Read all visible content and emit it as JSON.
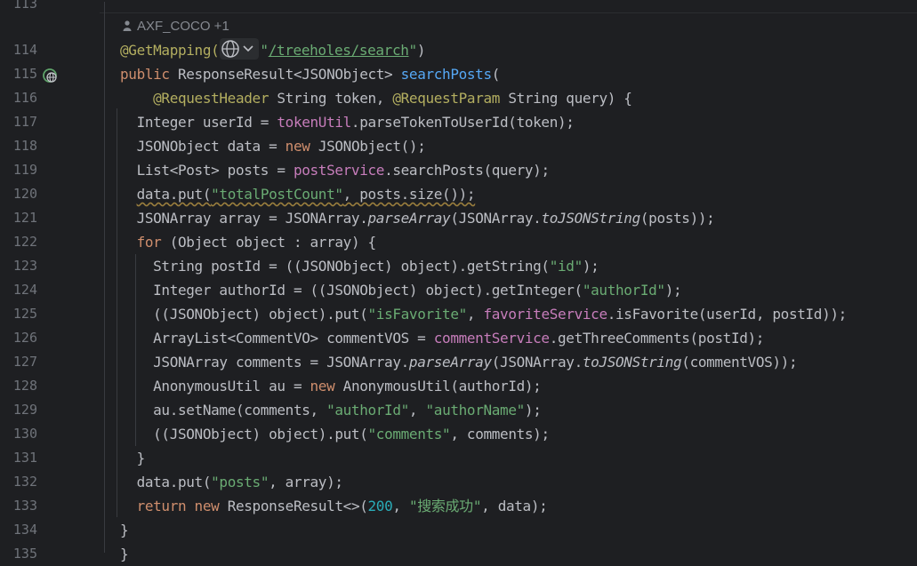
{
  "author_hint": "AXF_COCO +1",
  "lines": [
    {
      "n": "113",
      "t": []
    },
    {
      "n": "114",
      "t": [
        [
          "ann",
          "@GetMapping("
        ],
        [
          "globe",
          ""
        ],
        [
          "str",
          "\""
        ],
        [
          "url",
          "/treeholes/search"
        ],
        [
          "str",
          "\""
        ],
        [
          "",
          ")"
        ]
      ]
    },
    {
      "n": "115",
      "t": [
        [
          "kw",
          "public "
        ],
        [
          "",
          "ResponseResult<JSONObject> "
        ],
        [
          "fn",
          "searchPosts"
        ],
        [
          "",
          "("
        ]
      ]
    },
    {
      "n": "116",
      "t": [
        [
          "",
          "    "
        ],
        [
          "ann",
          "@RequestHeader "
        ],
        [
          "",
          "String token, "
        ],
        [
          "ann",
          "@RequestParam "
        ],
        [
          "",
          "String query) {"
        ]
      ]
    },
    {
      "n": "117",
      "t": [
        [
          "",
          "  Integer userId = "
        ],
        [
          "fld",
          "tokenUtil"
        ],
        [
          "",
          ".parseTokenToUserId(token);"
        ]
      ]
    },
    {
      "n": "118",
      "t": [
        [
          "",
          "  JSONObject data = "
        ],
        [
          "kw",
          "new "
        ],
        [
          "",
          "JSONObject();"
        ]
      ]
    },
    {
      "n": "119",
      "t": [
        [
          "",
          "  List<Post> posts = "
        ],
        [
          "fld",
          "postService"
        ],
        [
          "",
          ".searchPosts(query);"
        ]
      ]
    },
    {
      "n": "120",
      "t": [
        [
          "",
          "  "
        ],
        [
          "sq",
          "data.put("
        ],
        [
          "sqs",
          "\"totalPostCount\""
        ],
        [
          "sq",
          ", posts.size());"
        ]
      ]
    },
    {
      "n": "121",
      "t": [
        [
          "",
          "  JSONArray array = JSONArray."
        ],
        [
          "it",
          "parseArray"
        ],
        [
          "",
          "(JSONArray."
        ],
        [
          "it",
          "toJSONString"
        ],
        [
          "",
          "(posts));"
        ]
      ]
    },
    {
      "n": "122",
      "t": [
        [
          "",
          "  "
        ],
        [
          "kw",
          "for "
        ],
        [
          "",
          "(Object object : array) {"
        ]
      ]
    },
    {
      "n": "123",
      "t": [
        [
          "",
          "    String postId = ((JSONObject) object).getString("
        ],
        [
          "str",
          "\"id\""
        ],
        [
          "",
          ");"
        ]
      ]
    },
    {
      "n": "124",
      "t": [
        [
          "",
          "    Integer authorId = ((JSONObject) object).getInteger("
        ],
        [
          "str",
          "\"authorId\""
        ],
        [
          "",
          ");"
        ]
      ]
    },
    {
      "n": "125",
      "t": [
        [
          "",
          "    ((JSONObject) object).put("
        ],
        [
          "str",
          "\"isFavorite\""
        ],
        [
          "",
          ", "
        ],
        [
          "fld",
          "favoriteService"
        ],
        [
          "",
          ".isFavorite(userId, postId));"
        ]
      ]
    },
    {
      "n": "126",
      "t": [
        [
          "",
          "    ArrayList<CommentVO> commentVOS = "
        ],
        [
          "fld",
          "commentService"
        ],
        [
          "",
          ".getThreeComments(postId);"
        ]
      ]
    },
    {
      "n": "127",
      "t": [
        [
          "",
          "    JSONArray comments = JSONArray."
        ],
        [
          "it",
          "parseArray"
        ],
        [
          "",
          "(JSONArray."
        ],
        [
          "it",
          "toJSONString"
        ],
        [
          "",
          "(commentVOS));"
        ]
      ]
    },
    {
      "n": "128",
      "t": [
        [
          "",
          "    AnonymousUtil au = "
        ],
        [
          "kw",
          "new "
        ],
        [
          "",
          "AnonymousUtil(authorId);"
        ]
      ]
    },
    {
      "n": "129",
      "t": [
        [
          "",
          "    au.setName(comments, "
        ],
        [
          "str",
          "\"authorId\""
        ],
        [
          "",
          ", "
        ],
        [
          "str",
          "\"authorName\""
        ],
        [
          "",
          ");"
        ]
      ]
    },
    {
      "n": "130",
      "t": [
        [
          "",
          "    ((JSONObject) object).put("
        ],
        [
          "str",
          "\"comments\""
        ],
        [
          "",
          ", comments);"
        ]
      ]
    },
    {
      "n": "131",
      "t": [
        [
          "",
          "  }"
        ]
      ]
    },
    {
      "n": "132",
      "t": [
        [
          "",
          "  data.put("
        ],
        [
          "str",
          "\"posts\""
        ],
        [
          "",
          ", array);"
        ]
      ]
    },
    {
      "n": "133",
      "t": [
        [
          "",
          "  "
        ],
        [
          "kw",
          "return new "
        ],
        [
          "",
          "ResponseResult<>("
        ],
        [
          "num",
          "200"
        ],
        [
          "",
          ", "
        ],
        [
          "str",
          "\"搜索成功\""
        ],
        [
          "",
          ", data);"
        ]
      ]
    },
    {
      "n": "134",
      "t": [
        [
          "",
          "}"
        ]
      ]
    },
    {
      "n": "135",
      "t": [
        [
          "",
          "}"
        ]
      ]
    }
  ]
}
